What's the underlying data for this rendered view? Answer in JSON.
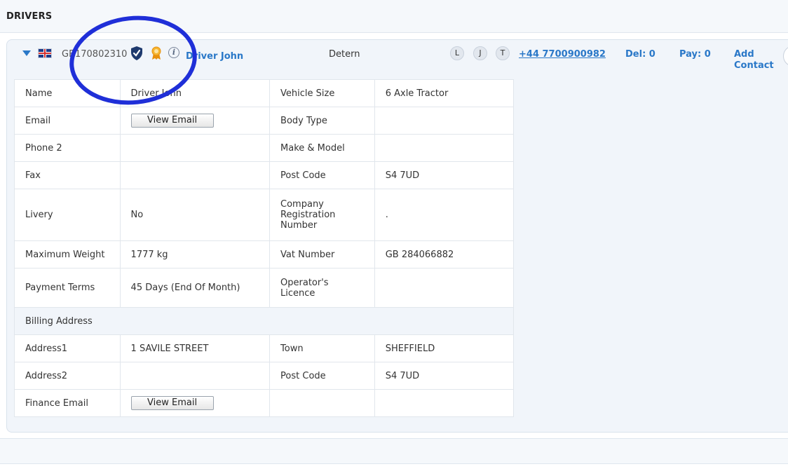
{
  "section": {
    "title": "DRIVERS"
  },
  "summary": {
    "reference": "GB170802310",
    "driver_name": "Driver John",
    "status": "Detern",
    "badges": [
      "L",
      "J",
      "T"
    ],
    "phone": "+44 7700900982",
    "del": "Del: 0",
    "pay": "Pay: 0",
    "add_contact": "Add Contact",
    "icons": [
      "caret-down-icon",
      "uk-flag-icon",
      "verified-shield-icon",
      "award-ribbon-icon",
      "info-icon"
    ]
  },
  "details": {
    "rows": [
      {
        "label1": "Name",
        "value1": "Driver John",
        "label2": "Vehicle Size",
        "value2": "6 Axle Tractor"
      },
      {
        "label1": "Email",
        "value1": "",
        "button1": "View Email",
        "label2": "Body Type",
        "value2": ""
      },
      {
        "label1": "Phone 2",
        "value1": "",
        "label2": "Make & Model",
        "value2": ""
      },
      {
        "label1": "Fax",
        "value1": "",
        "label2": "Post Code",
        "value2": "S4 7UD"
      },
      {
        "label1": "Livery",
        "value1": "No",
        "label2": "Company Registration Number",
        "value2": "."
      },
      {
        "label1": "Maximum Weight",
        "value1": "1777 kg",
        "label2": "Vat Number",
        "value2": "GB 284066882"
      },
      {
        "label1": "Payment Terms",
        "value1": "45 Days (End Of Month)",
        "label2": "Operator's Licence",
        "value2": ""
      }
    ],
    "billing_heading": "Billing Address",
    "billing_rows": [
      {
        "label1": "Address1",
        "value1": "1 SAVILE STREET",
        "label2": "Town",
        "value2": "SHEFFIELD"
      },
      {
        "label1": "Address2",
        "value1": "",
        "label2": "Post Code",
        "value2": "S4 7UD"
      },
      {
        "label1": "Finance Email",
        "value1": "",
        "button1": "View Email",
        "label2": "",
        "value2": ""
      }
    ]
  },
  "colors": {
    "link": "#2a78c8",
    "annotation": "#1f2fd8",
    "shield": "#1e3a6e",
    "award": "#f0a020"
  }
}
